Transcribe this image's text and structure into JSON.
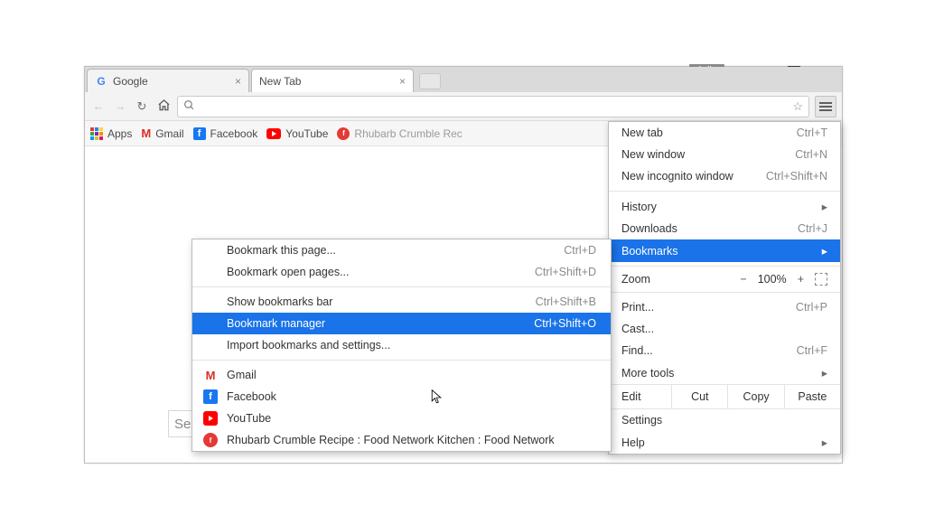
{
  "profile_name": "Julia",
  "tabs": [
    {
      "title": "Google",
      "active": false
    },
    {
      "title": "New Tab",
      "active": true
    }
  ],
  "omnibox": {
    "value": ""
  },
  "bookmarks_bar": {
    "apps": "Apps",
    "items": [
      {
        "label": "Gmail",
        "icon": "gmail-icon"
      },
      {
        "label": "Facebook",
        "icon": "fb-icon"
      },
      {
        "label": "YouTube",
        "icon": "yt-icon"
      },
      {
        "label": "Rhubarb Crumble Rec",
        "icon": "fn-icon"
      }
    ]
  },
  "content_search_placeholder": "Se",
  "main_menu": {
    "new_tab": {
      "label": "New tab",
      "shortcut": "Ctrl+T"
    },
    "new_window": {
      "label": "New window",
      "shortcut": "Ctrl+N"
    },
    "incognito": {
      "label": "New incognito window",
      "shortcut": "Ctrl+Shift+N"
    },
    "history": {
      "label": "History"
    },
    "downloads": {
      "label": "Downloads",
      "shortcut": "Ctrl+J"
    },
    "bookmarks": {
      "label": "Bookmarks"
    },
    "zoom": {
      "label": "Zoom",
      "minus": "−",
      "pct": "100%",
      "plus": "+"
    },
    "print": {
      "label": "Print...",
      "shortcut": "Ctrl+P"
    },
    "cast": {
      "label": "Cast..."
    },
    "find": {
      "label": "Find...",
      "shortcut": "Ctrl+F"
    },
    "more_tools": {
      "label": "More tools"
    },
    "edit": {
      "label": "Edit",
      "cut": "Cut",
      "copy": "Copy",
      "paste": "Paste"
    },
    "settings": {
      "label": "Settings"
    },
    "help": {
      "label": "Help"
    }
  },
  "bookmarks_submenu": {
    "bookmark_page": {
      "label": "Bookmark this page...",
      "shortcut": "Ctrl+D"
    },
    "bookmark_open": {
      "label": "Bookmark open pages...",
      "shortcut": "Ctrl+Shift+D"
    },
    "show_bar": {
      "label": "Show bookmarks bar",
      "shortcut": "Ctrl+Shift+B"
    },
    "manager": {
      "label": "Bookmark manager",
      "shortcut": "Ctrl+Shift+O"
    },
    "import": {
      "label": "Import bookmarks and settings..."
    },
    "items": [
      {
        "label": "Gmail",
        "icon": "gmail-icon"
      },
      {
        "label": "Facebook",
        "icon": "fb-icon"
      },
      {
        "label": "YouTube",
        "icon": "yt-icon"
      },
      {
        "label": "Rhubarb Crumble Recipe : Food Network Kitchen : Food Network",
        "icon": "fn-icon"
      }
    ]
  }
}
